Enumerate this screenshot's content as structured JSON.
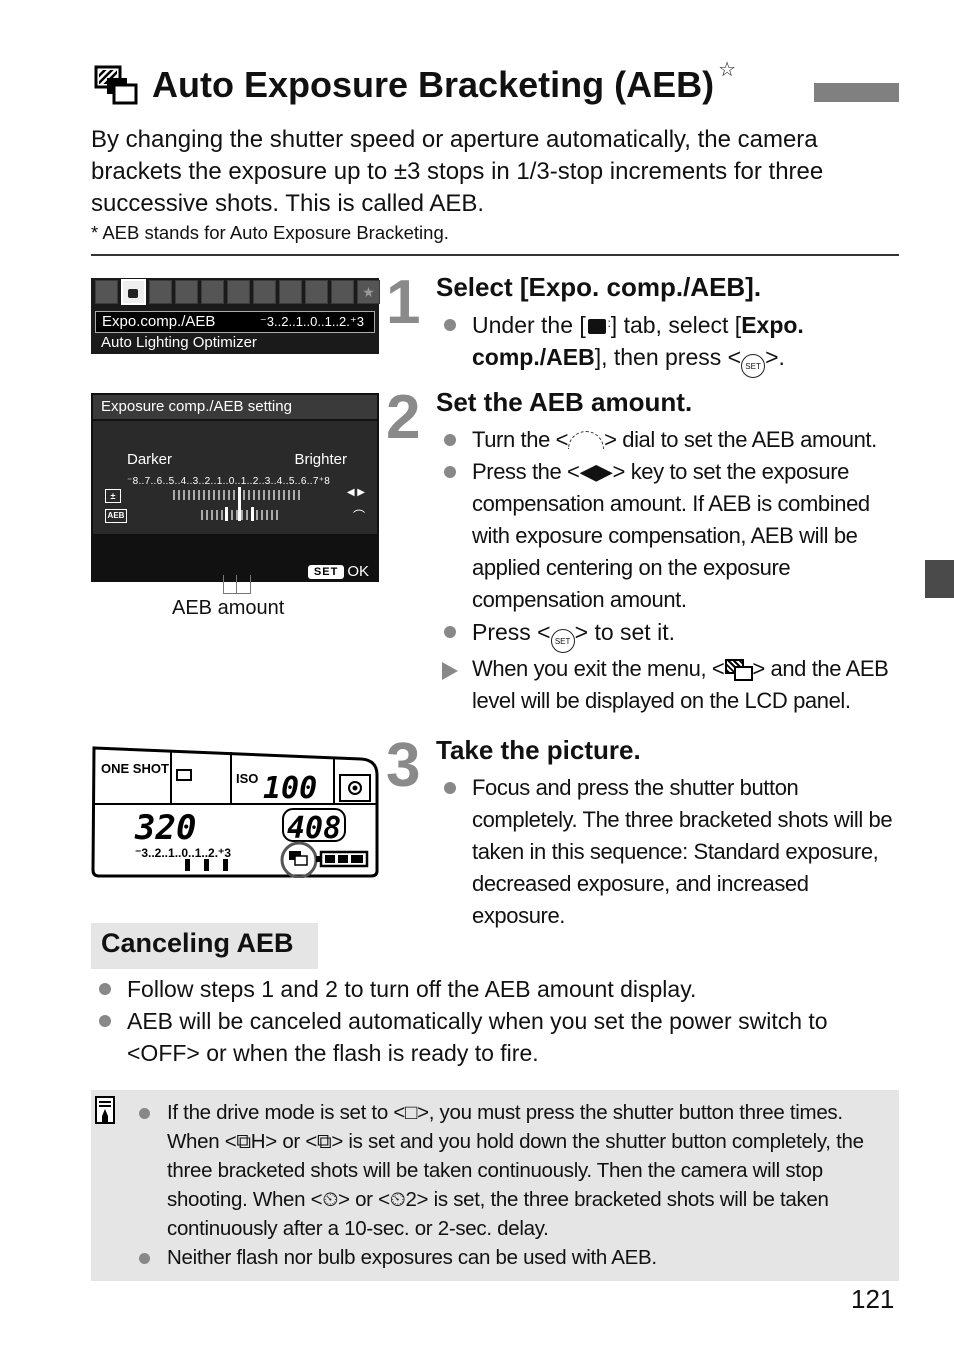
{
  "page": {
    "title": "Auto Exposure Bracketing (AEB)",
    "title_star": "☆",
    "title_icon": "aeb-bracketing-icon",
    "intro": "By changing the shutter speed or aperture automatically, the camera brackets the exposure up to ±3 stops in 1/3-stop increments for three successive shots. This is called AEB.",
    "footnote": "* AEB stands for Auto Exposure Bracketing.",
    "page_number": "121"
  },
  "screens": {
    "menu": {
      "row1_label": "Expo.comp./AEB",
      "row1_value": "⁻3..2..1..0..1..2.⁺3",
      "row2_label": "Auto Lighting Optimizer",
      "tab_count": 11,
      "active_tab_index": 1
    },
    "aeb_setting": {
      "header": "Exposure comp./AEB setting",
      "darker": "Darker",
      "brighter": "Brighter",
      "scale": "⁻8..7..6..5..4..3..2..1..0..1..2..3..4..5..6..7⁺8",
      "ev_icon": "±",
      "aeb_icon": "AEB",
      "lr_icon": "◀ ▶",
      "dial_icon": "⌒",
      "set_label": "SET",
      "ok_label": "OK",
      "callout_label": "AEB amount"
    },
    "lcd": {
      "af_mode": "ONE SHOT",
      "iso_label": "ISO",
      "iso_value": "100",
      "shutter": "320",
      "shots": "408",
      "scale": "⁻3..2..1..0..1..2.⁺3"
    }
  },
  "steps": [
    {
      "number": "1",
      "title": "Select [Expo. comp./AEB].",
      "items": [
        {
          "type": "bullet",
          "pre": "Under the [",
          "icon": "shooting-menu-2-icon",
          "mid": "] tab, select [",
          "bold": "Expo. comp./AEB",
          "post": "], then press <",
          "btn": "SET",
          "end": ">."
        }
      ]
    },
    {
      "number": "2",
      "title": "Set the AEB amount.",
      "items": [
        {
          "type": "bullet",
          "text_pre": "Turn the <",
          "icon": "main-dial-icon",
          "text_post": "> dial to set the AEB amount."
        },
        {
          "type": "bullet",
          "text_pre": "Press the <",
          "icon": "◀▶",
          "text_post": "> key to set the exposure compensation amount. If AEB is combined with exposure compensation, AEB will be applied centering on the exposure compensation amount."
        },
        {
          "type": "bullet",
          "text_pre": "Press <",
          "btn": "SET",
          "text_post": "> to set it."
        },
        {
          "type": "arrow",
          "text_pre": "When you exit the menu, <",
          "icon": "aeb-icon",
          "text_post": "> and the AEB level will be displayed on the LCD panel."
        }
      ]
    },
    {
      "number": "3",
      "title": "Take the picture.",
      "items": [
        {
          "type": "bullet",
          "text": "Focus and press the shutter button completely. The three bracketed shots will be taken in this sequence: Standard exposure, decreased exposure, and increased exposure."
        }
      ]
    }
  ],
  "canceling": {
    "heading": "Canceling AEB",
    "items": [
      "Follow steps 1 and 2 to turn off the AEB amount display.",
      "AEB will be canceled automatically when you set the power switch to <OFF> or when the flash is ready to fire."
    ]
  },
  "note": {
    "icon": "memo-pencil-icon",
    "items": [
      "If the drive mode is set to <□>, you must press the shutter button three times. When <⧉H> or <⧉> is set and you hold down the shutter button completely, the three bracketed shots will be taken continuously. Then the camera will stop shooting. When <⏲> or <⏲2> is set, the three bracketed shots will be taken continuously after a 10-sec. or 2-sec. delay.",
      "Neither flash nor bulb exposures can be used with AEB."
    ]
  },
  "colors": {
    "step_number": "#8a8a8a",
    "bullet": "#888888",
    "section_bg": "#e5e5e5",
    "side_tab": "#4a4a4a",
    "title_bar": "#808080"
  }
}
